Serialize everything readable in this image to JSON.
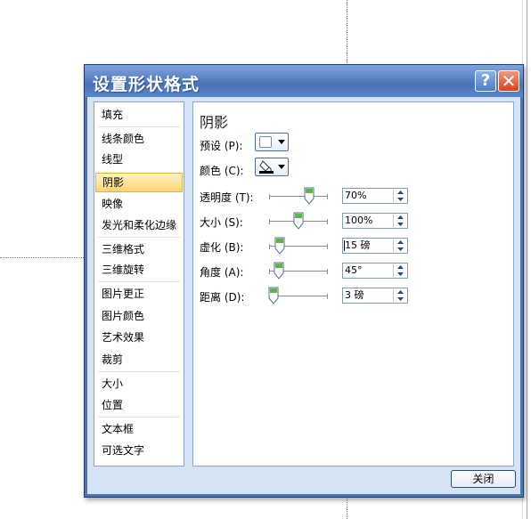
{
  "dialog": {
    "title": "设置形状格式",
    "help_glyph": "?",
    "close_glyph": "✕",
    "footer_close_label": "关闭"
  },
  "nav": {
    "selected": "阴影",
    "items": [
      {
        "label": "填充"
      },
      {
        "label": "线条颜色"
      },
      {
        "label": "线型"
      },
      {
        "label": "阴影"
      },
      {
        "label": "映像"
      },
      {
        "label": "发光和柔化边缘"
      },
      {
        "label": "三维格式"
      },
      {
        "label": "三维旋转"
      },
      {
        "label": "图片更正"
      },
      {
        "label": "图片颜色"
      },
      {
        "label": "艺术效果"
      },
      {
        "label": "裁剪"
      },
      {
        "label": "大小"
      },
      {
        "label": "位置"
      },
      {
        "label": "文本框"
      },
      {
        "label": "可选文字"
      }
    ]
  },
  "shadow": {
    "section_title": "阴影",
    "preset_label": "预设 (P):",
    "color_label": "颜色 (C):",
    "rows": [
      {
        "label": "透明度 (T):",
        "value": "70%",
        "level": 0.7
      },
      {
        "label": "大小 (S):",
        "value": "100%",
        "level": 0.5
      },
      {
        "label": "虚化 (B):",
        "value": "15 磅",
        "level": 0.15
      },
      {
        "label": "角度 (A):",
        "value": "45°",
        "level": 0.125
      },
      {
        "label": "距离 (D):",
        "value": "3 磅",
        "level": 0.03
      }
    ]
  },
  "colors": {
    "dialog_frame": "#4d74b1",
    "client_bg": "#d6e3f4",
    "selected_item": "#fcd472",
    "slider_thumb": "#5fb24a",
    "close_red": "#d8421d"
  },
  "icons": {
    "preset": "shadow-preset-swatch-icon",
    "color": "paint-bucket-icon",
    "dropdown": "dropdown-arrow-icon",
    "spin": "spin-up-down-icon",
    "thumb": "slider-thumb-icon"
  }
}
